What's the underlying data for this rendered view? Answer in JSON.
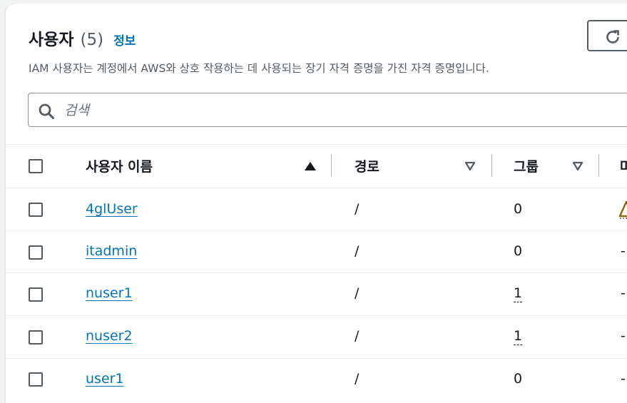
{
  "header": {
    "title": "사용자",
    "count": "(5)",
    "info_link": "정보",
    "description": "IAM 사용자는 계정에서 AWS와 상호 작용하는 데 사용되는 장기 자격 증명을 가진 자격 증명입니다."
  },
  "toolbar": {
    "refresh_icon": "refresh-icon"
  },
  "search": {
    "placeholder": "검색",
    "value": ""
  },
  "table": {
    "columns": [
      {
        "label": "사용자 이름",
        "sort": "ascending"
      },
      {
        "label": "경로",
        "sort": "none"
      },
      {
        "label": "그룹",
        "sort": "none"
      },
      {
        "label": "마",
        "sort": "none"
      }
    ],
    "rows": [
      {
        "user_name": "4glUser",
        "path": "/",
        "groups": "0",
        "last_activity": "warning-icon"
      },
      {
        "user_name": "itadmin",
        "path": "/",
        "groups": "0",
        "last_activity": "-"
      },
      {
        "user_name": "nuser1",
        "path": "/",
        "groups": "1",
        "last_activity": "-"
      },
      {
        "user_name": "nuser2",
        "path": "/",
        "groups": "1",
        "last_activity": "-"
      },
      {
        "user_name": "user1",
        "path": "/",
        "groups": "0",
        "last_activity": "-"
      }
    ]
  },
  "colors": {
    "link": "#0073bb",
    "text": "#16191f",
    "muted": "#545b64",
    "warning": "#8d6605"
  }
}
